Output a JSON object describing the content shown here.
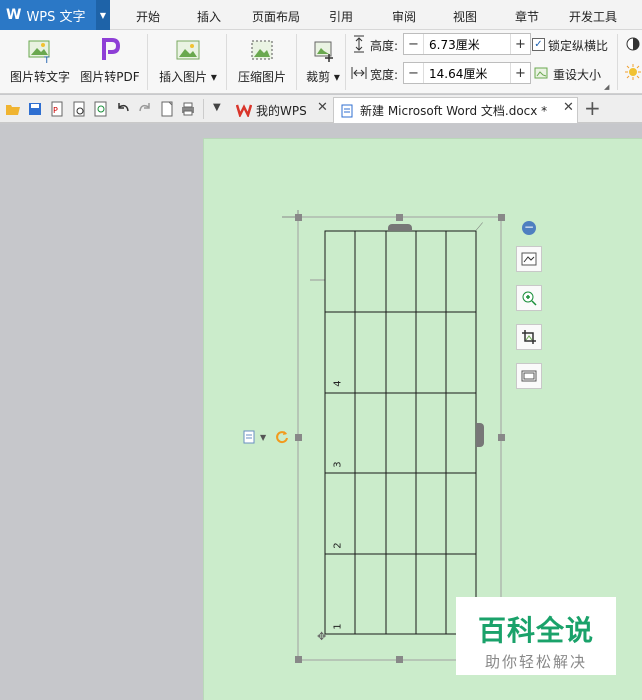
{
  "app": {
    "logo": "W",
    "name": "WPS 文字",
    "dropdown_icon": "triangle-down-icon"
  },
  "menu": [
    {
      "label": "开始"
    },
    {
      "label": "插入"
    },
    {
      "label": "页面布局"
    },
    {
      "label": "引用"
    },
    {
      "label": "审阅"
    },
    {
      "label": "视图"
    },
    {
      "label": "章节"
    },
    {
      "label": "开发工具"
    }
  ],
  "ribbon": {
    "pic_to_text": "图片转文字",
    "pic_to_pdf": "图片转PDF",
    "insert_pic": "插入图片",
    "compress_pic": "压缩图片",
    "crop": "裁剪",
    "height_label": "高度:",
    "height_value": "6.73厘米",
    "width_label": "宽度:",
    "width_value": "14.64厘米",
    "lock_ratio": "锁定纵横比",
    "reset_size": "重设大小"
  },
  "tabs": {
    "home_tab": "我的WPS",
    "doc_tab": "新建 Microsoft Word 文档.docx *",
    "new_tab_symbol": "+"
  },
  "table": {
    "row_labels": [
      "4",
      "3",
      "2",
      "1"
    ]
  },
  "watermark": {
    "main": "百科全说",
    "sub": "助你轻松解决"
  }
}
